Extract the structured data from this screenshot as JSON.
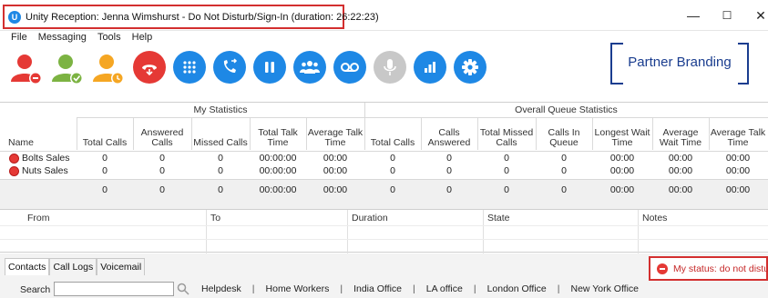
{
  "window": {
    "title": "Unity Reception: Jenna Wimshurst - Do Not Disturb/Sign-In (duration: 26:22:23)",
    "app_icon_letter": "U",
    "minimize": "—",
    "maximize": "☐",
    "close": "✕"
  },
  "menu": [
    "File",
    "Messaging",
    "Tools",
    "Help"
  ],
  "toolbar": {
    "icons": [
      {
        "name": "user-dnd-icon",
        "color": "#e53935"
      },
      {
        "name": "user-available-icon",
        "color": "#7cb342"
      },
      {
        "name": "user-away-icon",
        "color": "#f5a623"
      },
      {
        "name": "hangup-icon",
        "color": "#e53935"
      },
      {
        "name": "dialpad-icon",
        "color": "#1e88e5"
      },
      {
        "name": "transfer-call-icon",
        "color": "#1e88e5"
      },
      {
        "name": "hold-icon",
        "color": "#1e88e5"
      },
      {
        "name": "conference-icon",
        "color": "#1e88e5"
      },
      {
        "name": "voicemail-icon",
        "color": "#1e88e5"
      },
      {
        "name": "microphone-icon",
        "color": "#c8c8c8"
      },
      {
        "name": "statistics-icon",
        "color": "#1e88e5"
      },
      {
        "name": "settings-icon",
        "color": "#1e88e5"
      }
    ]
  },
  "branding": {
    "text": "Partner Branding",
    "color": "#1a3d8f"
  },
  "stats": {
    "my_statistics_label": "My Statistics",
    "overall_queue_label": "Overall Queue Statistics",
    "columns": [
      "Name",
      "Total Calls",
      "Answered Calls",
      "Missed Calls",
      "Total Talk Time",
      "Average Talk Time",
      "Total Calls",
      "Calls Answered",
      "Total Missed Calls",
      "Calls In Queue",
      "Longest Wait Time",
      "Average Wait Time",
      "Average Talk Time"
    ],
    "rows": [
      {
        "name": "Bolts Sales",
        "values": [
          "0",
          "0",
          "0",
          "00:00:00",
          "00:00",
          "0",
          "0",
          "0",
          "0",
          "00:00",
          "00:00",
          "00:00"
        ]
      },
      {
        "name": "Nuts Sales",
        "values": [
          "0",
          "0",
          "0",
          "00:00:00",
          "00:00",
          "0",
          "0",
          "0",
          "0",
          "00:00",
          "00:00",
          "00:00"
        ]
      }
    ],
    "totals": [
      "0",
      "0",
      "0",
      "00:00:00",
      "00:00",
      "0",
      "0",
      "0",
      "0",
      "00:00",
      "00:00",
      "00:00"
    ]
  },
  "history": {
    "columns": [
      "From",
      "To",
      "Duration",
      "State",
      "Notes"
    ]
  },
  "tabs": [
    "Contacts",
    "Call Logs",
    "Voicemail"
  ],
  "status": {
    "text": "My status: do not disturb"
  },
  "search": {
    "label": "Search",
    "value": ""
  },
  "filters": [
    "Helpdesk",
    "Home Workers",
    "India Office",
    "LA office",
    "London Office",
    "New York Office"
  ]
}
